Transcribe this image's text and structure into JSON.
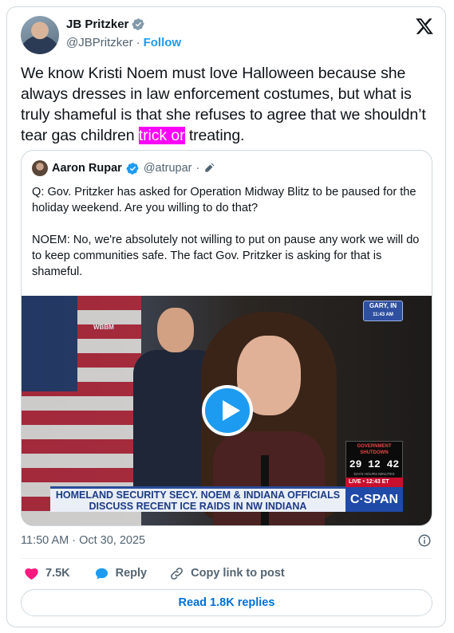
{
  "author": {
    "name": "JB Pritzker",
    "handle": "@JBPritzker",
    "separator": "·",
    "follow_label": "Follow"
  },
  "tweet": {
    "text_before": "We know Kristi Noem must love Halloween because she always dresses in law enforcement costumes, but what is truly shameful is that she refuses to agree that we shouldn’t tear gas children ",
    "highlighted": "trick or",
    "text_after": " treating."
  },
  "quote": {
    "name": "Aaron Rupar",
    "handle": "@atrupar",
    "separator": "·",
    "body": "Q: Gov. Pritzker has asked for Operation Midway Blitz to be paused for the holiday weekend. Are you willing to do that?\n\nNOEM: No, we're absolutely not willing to put on pause any work we will do to keep communities safe. The fact Gov. Pritzker is asking for that is shameful."
  },
  "video": {
    "location_line1": "GARY, IN",
    "location_line2": "11:43 AM",
    "station": "WBBM",
    "shutdown_label": "GOVERNMENT SHUTDOWN",
    "shutdown_counter": "29 12 42",
    "shutdown_units": "DAYS HOURS MINUTES",
    "live_label": "LIVE • 12:43 ET",
    "lower_third_line1": "HOMELAND SECURITY SECY. NOEM & INDIANA OFFICIALS",
    "lower_third_line2": "DISCUSS RECENT ICE RAIDS IN NW INDIANA",
    "network": "C·SPAN"
  },
  "timestamp": "11:50 AM · Oct 30, 2025",
  "actions": {
    "likes": "7.5K",
    "reply_label": "Reply",
    "copy_label": "Copy link to post"
  },
  "read_replies_label": "Read 1.8K replies",
  "colors": {
    "accent": "#1d9bf0",
    "like": "#f91880",
    "highlight": "#ff00ff",
    "link": "#006fd6"
  }
}
